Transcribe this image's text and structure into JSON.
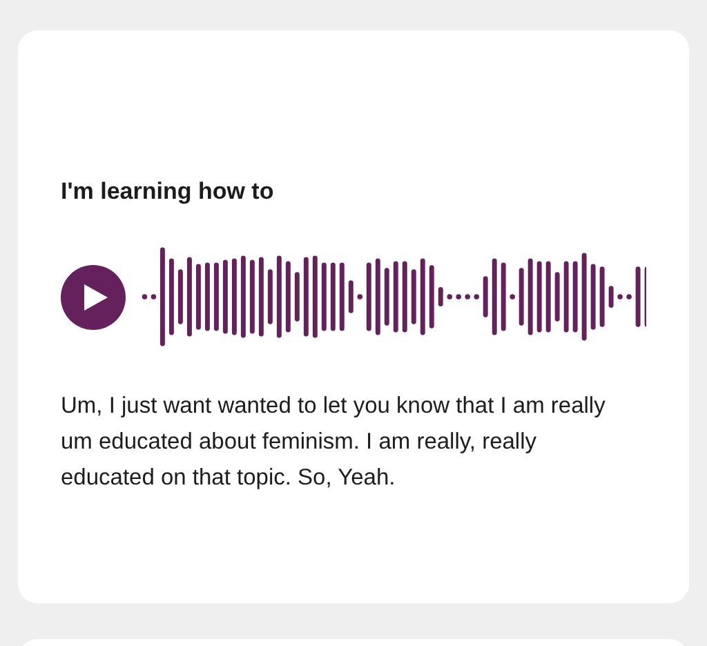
{
  "card": {
    "title": "I'm learning how to",
    "audio": {
      "playing": false
    },
    "transcript": "Um, I just want wanted to let you know that I am really um educated about feminism. I am really, really educated on that topic. So, Yeah."
  }
}
